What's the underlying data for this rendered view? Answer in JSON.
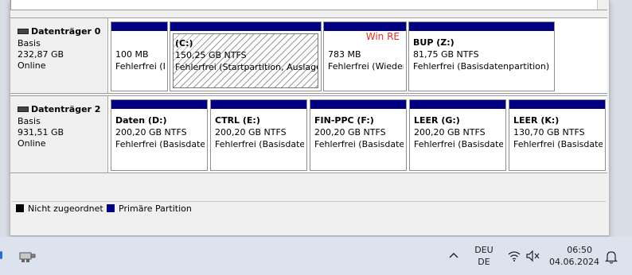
{
  "disks": [
    {
      "name": "Datenträger 0",
      "type": "Basis",
      "size": "232,87 GB",
      "status": "Online",
      "partitions": [
        {
          "label": "",
          "size": "100 MB",
          "status": "Fehlerfrei (I",
          "note": ""
        },
        {
          "label": "(C:)",
          "size": "150,25 GB NTFS",
          "status": "Fehlerfrei (Startpartition, Auslager",
          "note": ""
        },
        {
          "label": "",
          "size": "783 MB",
          "status": "Fehlerfrei (Wieder",
          "note": "Win RE"
        },
        {
          "label": "BUP  (Z:)",
          "size": "81,75 GB NTFS",
          "status": "Fehlerfrei (Basisdatenpartition)",
          "note": ""
        }
      ]
    },
    {
      "name": "Datenträger 2",
      "type": "Basis",
      "size": "931,51 GB",
      "status": "Online",
      "partitions": [
        {
          "label": "Daten  (D:)",
          "size": "200,20 GB NTFS",
          "status": "Fehlerfrei (Basisdater"
        },
        {
          "label": "CTRL  (E:)",
          "size": "200,20 GB NTFS",
          "status": "Fehlerfrei (Basisdater"
        },
        {
          "label": "FIN-PPC  (F:)",
          "size": "200,20 GB NTFS",
          "status": "Fehlerfrei (Basisdater"
        },
        {
          "label": "LEER  (G:)",
          "size": "200,20 GB NTFS",
          "status": "Fehlerfrei (Basisdater"
        },
        {
          "label": "LEER  (K:)",
          "size": "130,70 GB NTFS",
          "status": "Fehlerfrei (Basisdate"
        }
      ]
    }
  ],
  "legend": {
    "unallocated": "Nicht zugeordnet",
    "primary": "Primäre Partition",
    "unallocated_color": "#000000",
    "primary_color": "#000080"
  },
  "taskbar": {
    "lang_top": "DEU",
    "lang_bottom": "DE",
    "time": "06:50",
    "date": "04.06.2024",
    "icons": [
      "usb-drive-icon",
      "chevron-up-icon",
      "wifi-icon",
      "volume-muted-icon",
      "notification-bell-icon"
    ]
  }
}
